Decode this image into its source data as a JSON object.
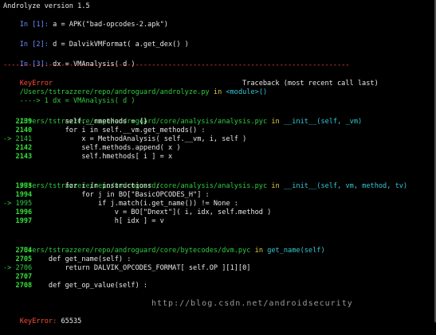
{
  "header": {
    "title": "Androlyze version 1.5"
  },
  "inputs": [
    {
      "prompt": "In [1]:",
      "code": "a = APK(\"bad-opcodes-2.apk\")"
    },
    {
      "prompt": "In [2]:",
      "code": "d = DalvikVMFormat( a.get_dex() )"
    },
    {
      "prompt": "In [3]:",
      "code": "dx = VMAnalysis( d )"
    }
  ],
  "separator": "------------------------------------------------------------------------------------",
  "traceback": {
    "error_name": "KeyError",
    "header": "Traceback (most recent call last)",
    "frame1": {
      "path": "/Users/tstrazzere/repo/androguard/androlyze.py",
      "in": "in",
      "func": "<module>()",
      "arrow_line": "----> 1 dx = VMAnalysis( d )"
    },
    "frame2": {
      "path": "/Users/tstrazzere/repo/androguard/core/analysis/analysis.pyc",
      "in": "in",
      "func": "__init__(self, _vm)",
      "lines": [
        {
          "prefix": "   ",
          "num": "2139",
          "code": "        self.__nmethods = {}"
        },
        {
          "prefix": "   ",
          "num": "2140",
          "code": "        for i in self.__vm.get_methods() :"
        },
        {
          "prefix": "-> ",
          "num": "2141",
          "code": "            x = MethodAnalysis( self.__vm, i, self )"
        },
        {
          "prefix": "   ",
          "num": "2142",
          "code": "            self.methods.append( x )"
        },
        {
          "prefix": "   ",
          "num": "2143",
          "code": "            self.hmethods[ i ] = x"
        }
      ]
    },
    "frame3": {
      "path": "/Users/tstrazzere/repo/androguard/core/analysis/analysis.pyc",
      "in": "in",
      "func": "__init__(self, vm, method, tv)",
      "lines": [
        {
          "prefix": "   ",
          "num": "1993",
          "code": "        for i in instructions :"
        },
        {
          "prefix": "   ",
          "num": "1994",
          "code": "            for j in BO[\"BasicOPCODES_H\"] :"
        },
        {
          "prefix": "-> ",
          "num": "1995",
          "code": "                if j.match(i.get_name()) != None :"
        },
        {
          "prefix": "   ",
          "num": "1996",
          "code": "                    v = BO[\"Dnext\"]( i, idx, self.method )"
        },
        {
          "prefix": "   ",
          "num": "1997",
          "code": "                    h[ idx ] = v"
        }
      ]
    },
    "frame4": {
      "path": "/Users/tstrazzere/repo/androguard/core/bytecodes/dvm.pyc",
      "in": "in",
      "func": "get_name(self)",
      "lines": [
        {
          "prefix": "   ",
          "num": "2704",
          "code": ""
        },
        {
          "prefix": "   ",
          "num": "2705",
          "code": "    def get_name(self) :"
        },
        {
          "prefix": "-> ",
          "num": "2706",
          "code": "        return DALVIK_OPCODES_FORMAT[ self.OP ][1][0]"
        },
        {
          "prefix": "   ",
          "num": "2707",
          "code": ""
        },
        {
          "prefix": "   ",
          "num": "2708",
          "code": "    def get_op_value(self) :"
        }
      ]
    },
    "final": {
      "error": "KeyError:",
      "value": "65535"
    }
  },
  "watermark": "http://blog.csdn.net/androidsecurity",
  "colors": {
    "background": "#000000",
    "text": "#e8e8e8",
    "prompt": "#6b8cff",
    "error": "#ff4a3a",
    "path": "#2ecc40",
    "function": "#33c9d6"
  }
}
